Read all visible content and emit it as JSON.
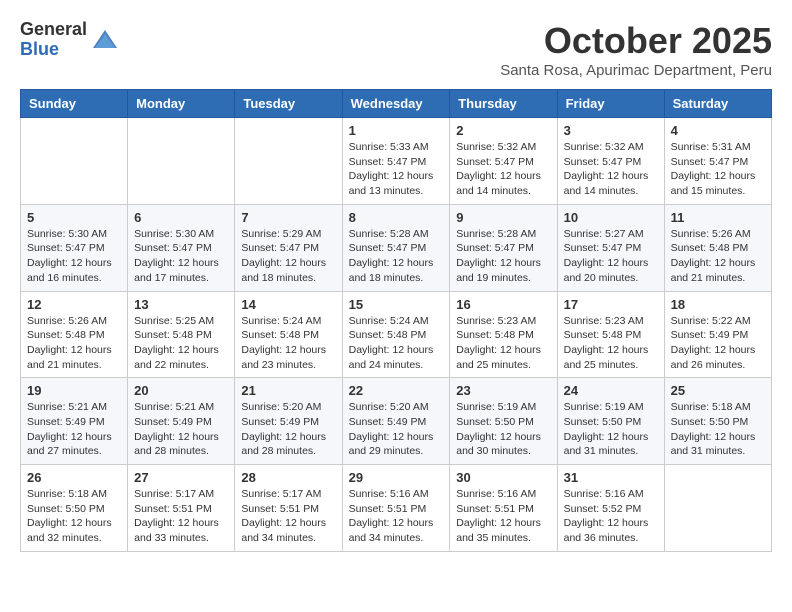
{
  "logo": {
    "general": "General",
    "blue": "Blue"
  },
  "header": {
    "month": "October 2025",
    "location": "Santa Rosa, Apurimac Department, Peru"
  },
  "weekdays": [
    "Sunday",
    "Monday",
    "Tuesday",
    "Wednesday",
    "Thursday",
    "Friday",
    "Saturday"
  ],
  "weeks": [
    [
      {
        "day": "",
        "info": ""
      },
      {
        "day": "",
        "info": ""
      },
      {
        "day": "",
        "info": ""
      },
      {
        "day": "1",
        "info": "Sunrise: 5:33 AM\nSunset: 5:47 PM\nDaylight: 12 hours\nand 13 minutes."
      },
      {
        "day": "2",
        "info": "Sunrise: 5:32 AM\nSunset: 5:47 PM\nDaylight: 12 hours\nand 14 minutes."
      },
      {
        "day": "3",
        "info": "Sunrise: 5:32 AM\nSunset: 5:47 PM\nDaylight: 12 hours\nand 14 minutes."
      },
      {
        "day": "4",
        "info": "Sunrise: 5:31 AM\nSunset: 5:47 PM\nDaylight: 12 hours\nand 15 minutes."
      }
    ],
    [
      {
        "day": "5",
        "info": "Sunrise: 5:30 AM\nSunset: 5:47 PM\nDaylight: 12 hours\nand 16 minutes."
      },
      {
        "day": "6",
        "info": "Sunrise: 5:30 AM\nSunset: 5:47 PM\nDaylight: 12 hours\nand 17 minutes."
      },
      {
        "day": "7",
        "info": "Sunrise: 5:29 AM\nSunset: 5:47 PM\nDaylight: 12 hours\nand 18 minutes."
      },
      {
        "day": "8",
        "info": "Sunrise: 5:28 AM\nSunset: 5:47 PM\nDaylight: 12 hours\nand 18 minutes."
      },
      {
        "day": "9",
        "info": "Sunrise: 5:28 AM\nSunset: 5:47 PM\nDaylight: 12 hours\nand 19 minutes."
      },
      {
        "day": "10",
        "info": "Sunrise: 5:27 AM\nSunset: 5:47 PM\nDaylight: 12 hours\nand 20 minutes."
      },
      {
        "day": "11",
        "info": "Sunrise: 5:26 AM\nSunset: 5:48 PM\nDaylight: 12 hours\nand 21 minutes."
      }
    ],
    [
      {
        "day": "12",
        "info": "Sunrise: 5:26 AM\nSunset: 5:48 PM\nDaylight: 12 hours\nand 21 minutes."
      },
      {
        "day": "13",
        "info": "Sunrise: 5:25 AM\nSunset: 5:48 PM\nDaylight: 12 hours\nand 22 minutes."
      },
      {
        "day": "14",
        "info": "Sunrise: 5:24 AM\nSunset: 5:48 PM\nDaylight: 12 hours\nand 23 minutes."
      },
      {
        "day": "15",
        "info": "Sunrise: 5:24 AM\nSunset: 5:48 PM\nDaylight: 12 hours\nand 24 minutes."
      },
      {
        "day": "16",
        "info": "Sunrise: 5:23 AM\nSunset: 5:48 PM\nDaylight: 12 hours\nand 25 minutes."
      },
      {
        "day": "17",
        "info": "Sunrise: 5:23 AM\nSunset: 5:48 PM\nDaylight: 12 hours\nand 25 minutes."
      },
      {
        "day": "18",
        "info": "Sunrise: 5:22 AM\nSunset: 5:49 PM\nDaylight: 12 hours\nand 26 minutes."
      }
    ],
    [
      {
        "day": "19",
        "info": "Sunrise: 5:21 AM\nSunset: 5:49 PM\nDaylight: 12 hours\nand 27 minutes."
      },
      {
        "day": "20",
        "info": "Sunrise: 5:21 AM\nSunset: 5:49 PM\nDaylight: 12 hours\nand 28 minutes."
      },
      {
        "day": "21",
        "info": "Sunrise: 5:20 AM\nSunset: 5:49 PM\nDaylight: 12 hours\nand 28 minutes."
      },
      {
        "day": "22",
        "info": "Sunrise: 5:20 AM\nSunset: 5:49 PM\nDaylight: 12 hours\nand 29 minutes."
      },
      {
        "day": "23",
        "info": "Sunrise: 5:19 AM\nSunset: 5:50 PM\nDaylight: 12 hours\nand 30 minutes."
      },
      {
        "day": "24",
        "info": "Sunrise: 5:19 AM\nSunset: 5:50 PM\nDaylight: 12 hours\nand 31 minutes."
      },
      {
        "day": "25",
        "info": "Sunrise: 5:18 AM\nSunset: 5:50 PM\nDaylight: 12 hours\nand 31 minutes."
      }
    ],
    [
      {
        "day": "26",
        "info": "Sunrise: 5:18 AM\nSunset: 5:50 PM\nDaylight: 12 hours\nand 32 minutes."
      },
      {
        "day": "27",
        "info": "Sunrise: 5:17 AM\nSunset: 5:51 PM\nDaylight: 12 hours\nand 33 minutes."
      },
      {
        "day": "28",
        "info": "Sunrise: 5:17 AM\nSunset: 5:51 PM\nDaylight: 12 hours\nand 34 minutes."
      },
      {
        "day": "29",
        "info": "Sunrise: 5:16 AM\nSunset: 5:51 PM\nDaylight: 12 hours\nand 34 minutes."
      },
      {
        "day": "30",
        "info": "Sunrise: 5:16 AM\nSunset: 5:51 PM\nDaylight: 12 hours\nand 35 minutes."
      },
      {
        "day": "31",
        "info": "Sunrise: 5:16 AM\nSunset: 5:52 PM\nDaylight: 12 hours\nand 36 minutes."
      },
      {
        "day": "",
        "info": ""
      }
    ]
  ]
}
